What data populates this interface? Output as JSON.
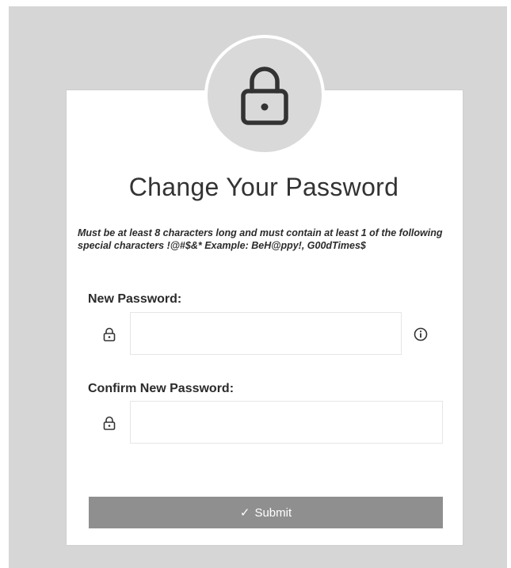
{
  "header": {
    "lock_icon": "lock-icon",
    "title": "Change Your Password"
  },
  "requirements": {
    "text": "Must be at least 8 characters long and must contain at least 1 of the following special characters !@#$&* Example: BeH@ppy!, G00dTimes$"
  },
  "form": {
    "new_password": {
      "label": "New Password:",
      "value": "",
      "icon": "lock-icon",
      "info_icon": "info-icon"
    },
    "confirm_password": {
      "label": "Confirm New Password:",
      "value": "",
      "icon": "lock-icon"
    },
    "submit": {
      "icon_glyph": "✓",
      "label": "Submit"
    }
  },
  "colors": {
    "background": "#d6d6d6",
    "card": "#ffffff",
    "submit_button": "#8f8f8f"
  }
}
